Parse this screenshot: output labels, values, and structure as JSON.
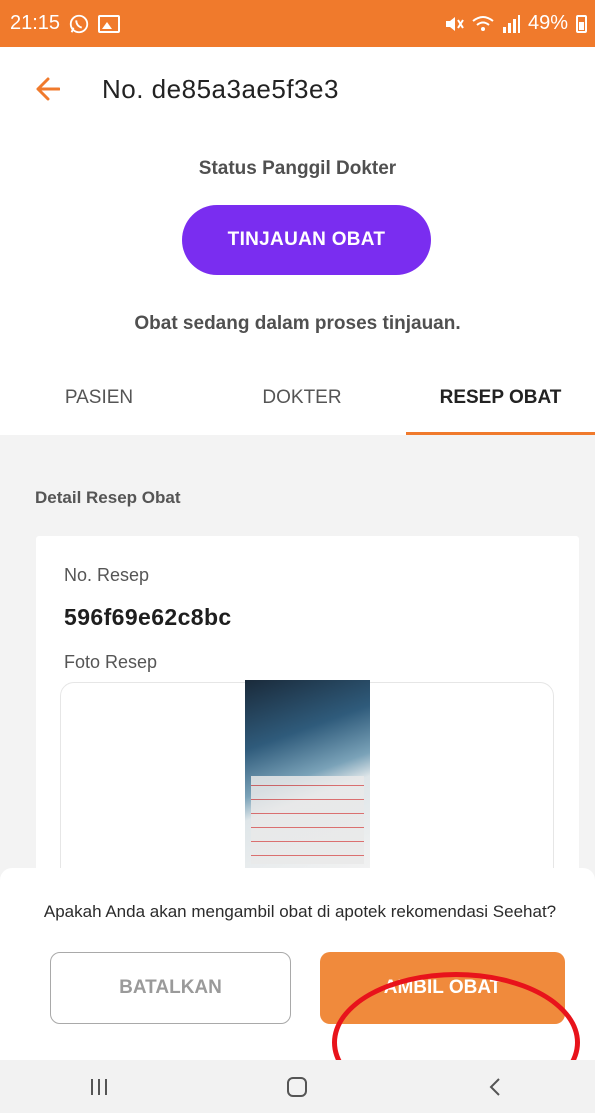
{
  "status_bar": {
    "time": "21:15",
    "battery": "49%"
  },
  "header": {
    "title": "No. de85a3ae5f3e3"
  },
  "status": {
    "label": "Status Panggil Dokter",
    "badge": "TINJAUAN OBAT",
    "message": "Obat sedang dalam proses tinjauan."
  },
  "tabs": [
    {
      "label": "PASIEN"
    },
    {
      "label": "DOKTER"
    },
    {
      "label": "RESEP OBAT"
    }
  ],
  "detail": {
    "section_title": "Detail Resep Obat",
    "resep_label": "No. Resep",
    "resep_value": "596f69e62c8bc",
    "foto_label": "Foto Resep"
  },
  "dialog": {
    "prompt": "Apakah Anda akan mengambil obat di apotek rekomendasi Seehat?",
    "cancel_label": "BATALKAN",
    "confirm_label": "AMBIL OBAT"
  },
  "colors": {
    "accent": "#f07a2c",
    "badge": "#7a2df0",
    "annotation": "#e8131b"
  }
}
